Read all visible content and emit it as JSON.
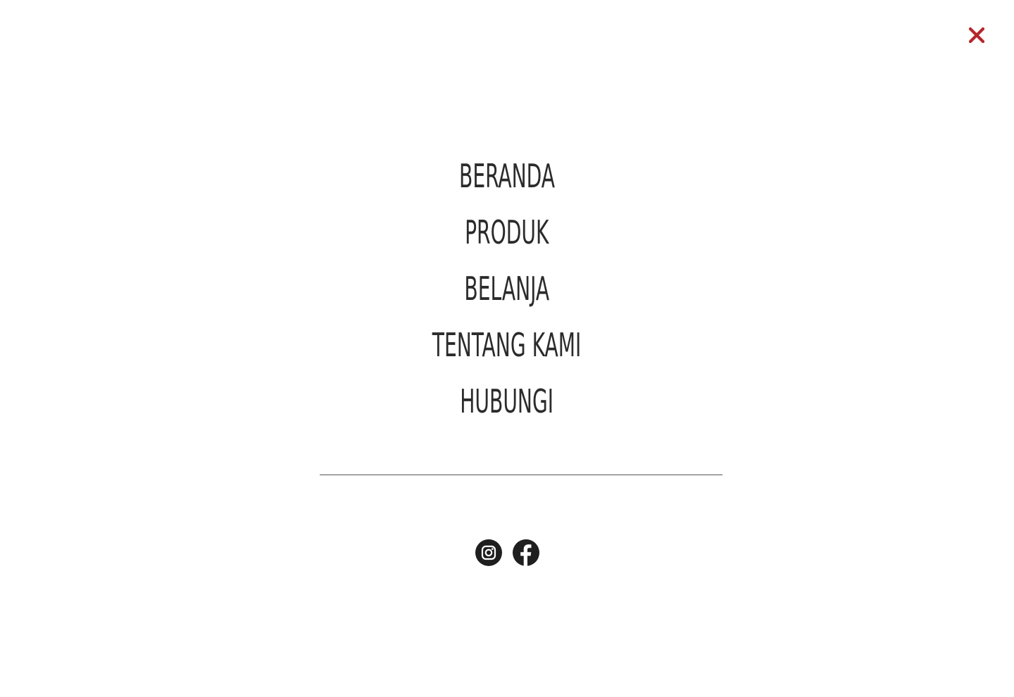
{
  "colors": {
    "background": "#ffffff",
    "close": "#b5262b",
    "text": "#2b2b2b",
    "icon_bg": "#1f1f1f"
  },
  "close_button": {
    "icon": "close-icon"
  },
  "nav": {
    "items": [
      {
        "label": "Beranda"
      },
      {
        "label": "Produk"
      },
      {
        "label": "Belanja"
      },
      {
        "label": "Tentang Kami"
      },
      {
        "label": "Hubungi"
      }
    ]
  },
  "social": {
    "items": [
      {
        "icon": "instagram-icon"
      },
      {
        "icon": "facebook-icon"
      }
    ]
  }
}
